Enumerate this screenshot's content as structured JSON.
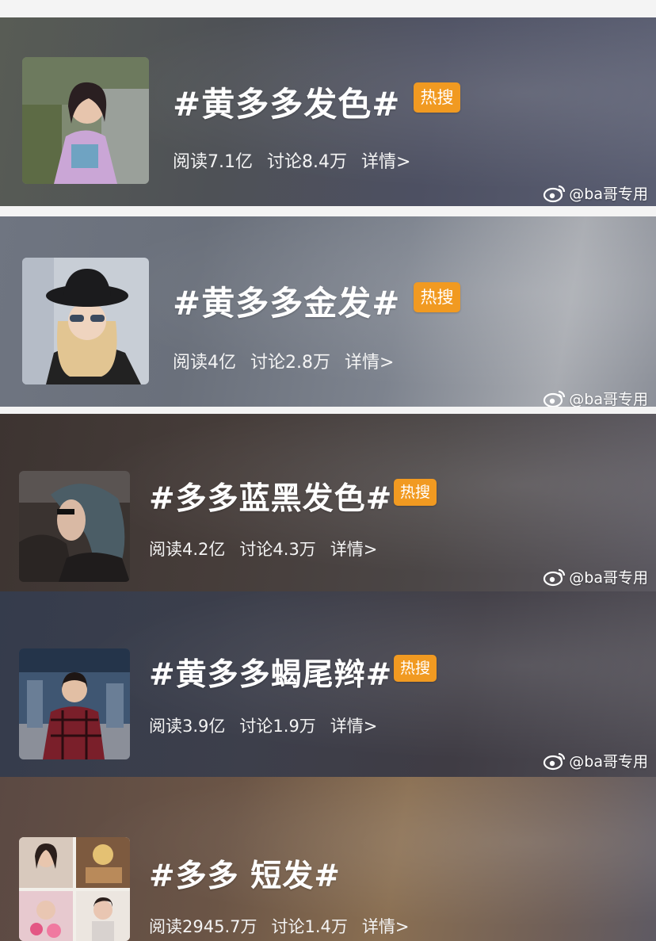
{
  "watermark": "@ba哥专用",
  "badge_label": "热搜",
  "topics": [
    {
      "title": "#黄多多发色#",
      "reads": "阅读7.1亿",
      "discussions": "讨论8.4万",
      "details": "详情>"
    },
    {
      "title": "#黄多多金发#",
      "reads": "阅读4亿",
      "discussions": "讨论2.8万",
      "details": "详情>"
    },
    {
      "title": "#多多蓝黑发色#",
      "reads": "阅读4.2亿",
      "discussions": "讨论4.3万",
      "details": "详情>"
    },
    {
      "title": "#黄多多蝎尾辫#",
      "reads": "阅读3.9亿",
      "discussions": "讨论1.9万",
      "details": "详情>"
    },
    {
      "title": "#多多 短发#",
      "reads": "阅读2945.7万",
      "discussions": "讨论1.4万",
      "details": "详情>"
    }
  ]
}
